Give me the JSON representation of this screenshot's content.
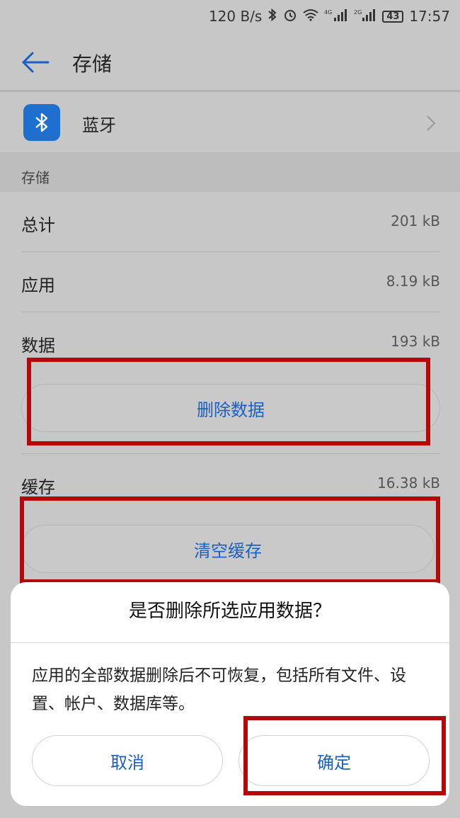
{
  "status_bar": {
    "network_speed": "120 B/s",
    "bluetooth_icon": "bluetooth-icon",
    "alarm_icon": "alarm-icon",
    "wifi_icon": "wifi-icon",
    "signal1_label": "4G",
    "signal2_label": "2G",
    "battery": "43",
    "time": "17:57"
  },
  "header": {
    "title": "存储"
  },
  "app": {
    "name": "蓝牙",
    "icon": "bluetooth-icon"
  },
  "storage": {
    "section_label": "存储",
    "total_label": "总计",
    "total_value": "201 kB",
    "app_label": "应用",
    "app_value": "8.19 kB",
    "data_label": "数据",
    "data_value": "193 kB",
    "delete_data_button": "删除数据",
    "cache_label": "缓存",
    "cache_value": "16.38 kB",
    "clear_cache_button": "清空缓存"
  },
  "dialog": {
    "title": "是否删除所选应用数据？",
    "message": "应用的全部数据删除后不可恢复，包括所有文件、设置、帐户、数据库等。",
    "cancel": "取消",
    "confirm": "确定"
  },
  "colors": {
    "accent": "#1a5fc4",
    "annotation": "#b50808",
    "app_icon_bg": "#1e6fd0"
  }
}
